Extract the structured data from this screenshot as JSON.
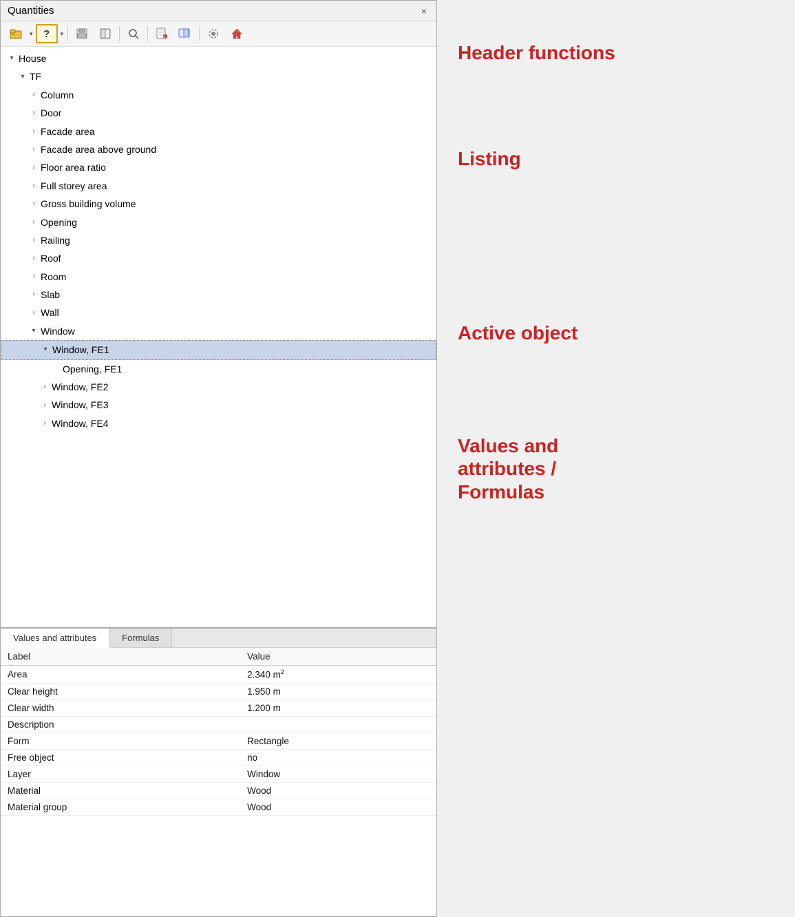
{
  "window": {
    "title": "Quantities",
    "close_label": "×"
  },
  "toolbar": {
    "buttons": [
      {
        "id": "folder-btn",
        "icon": "📁",
        "label": "Folder",
        "active": false
      },
      {
        "id": "dropdown-arrow-1",
        "icon": "▾",
        "label": "Dropdown",
        "active": false
      },
      {
        "id": "help-btn",
        "icon": "?",
        "label": "Help",
        "active": true
      },
      {
        "id": "dropdown-arrow-2",
        "icon": "▾",
        "label": "Dropdown",
        "active": false
      },
      {
        "id": "save-btn",
        "icon": "💾",
        "label": "Save",
        "active": false
      },
      {
        "id": "book-btn",
        "icon": "📓",
        "label": "Book",
        "active": false
      },
      {
        "id": "search-btn",
        "icon": "🔍",
        "label": "Search",
        "active": false
      },
      {
        "id": "report-btn",
        "icon": "📋",
        "label": "Report",
        "active": false
      },
      {
        "id": "export-btn",
        "icon": "📤",
        "label": "Export",
        "active": false
      },
      {
        "id": "settings-btn",
        "icon": "⚙",
        "label": "Settings",
        "active": false
      },
      {
        "id": "home-btn",
        "icon": "🏠",
        "label": "Home",
        "active": false
      }
    ]
  },
  "tree": {
    "items": [
      {
        "id": "house",
        "label": "House",
        "indent": 0,
        "expanded": true,
        "type": "expanded"
      },
      {
        "id": "tf",
        "label": "TF",
        "indent": 1,
        "expanded": true,
        "type": "expanded"
      },
      {
        "id": "column",
        "label": "Column",
        "indent": 2,
        "expanded": false,
        "type": "collapsed"
      },
      {
        "id": "door",
        "label": "Door",
        "indent": 2,
        "expanded": false,
        "type": "collapsed"
      },
      {
        "id": "facade-area",
        "label": "Facade area",
        "indent": 2,
        "expanded": false,
        "type": "collapsed"
      },
      {
        "id": "facade-area-above",
        "label": "Facade area above ground",
        "indent": 2,
        "expanded": false,
        "type": "collapsed"
      },
      {
        "id": "floor-area-ratio",
        "label": "Floor area ratio",
        "indent": 2,
        "expanded": false,
        "type": "collapsed"
      },
      {
        "id": "full-storey-area",
        "label": "Full storey area",
        "indent": 2,
        "expanded": false,
        "type": "collapsed"
      },
      {
        "id": "gross-building-volume",
        "label": "Gross building volume",
        "indent": 2,
        "expanded": false,
        "type": "collapsed"
      },
      {
        "id": "opening",
        "label": "Opening",
        "indent": 2,
        "expanded": false,
        "type": "collapsed"
      },
      {
        "id": "railing",
        "label": "Railing",
        "indent": 2,
        "expanded": false,
        "type": "collapsed"
      },
      {
        "id": "roof",
        "label": "Roof",
        "indent": 2,
        "expanded": false,
        "type": "collapsed"
      },
      {
        "id": "room",
        "label": "Room",
        "indent": 2,
        "expanded": false,
        "type": "collapsed"
      },
      {
        "id": "slab",
        "label": "Slab",
        "indent": 2,
        "expanded": false,
        "type": "collapsed"
      },
      {
        "id": "wall",
        "label": "Wall",
        "indent": 2,
        "expanded": false,
        "type": "collapsed"
      },
      {
        "id": "window",
        "label": "Window",
        "indent": 2,
        "expanded": true,
        "type": "expanded"
      },
      {
        "id": "window-fe1",
        "label": "Window, FE1",
        "indent": 3,
        "expanded": true,
        "type": "expanded",
        "selected": true
      },
      {
        "id": "opening-fe1",
        "label": "Opening, FE1",
        "indent": 4,
        "expanded": false,
        "type": "leaf"
      },
      {
        "id": "window-fe2",
        "label": "Window, FE2",
        "indent": 3,
        "expanded": false,
        "type": "collapsed"
      },
      {
        "id": "window-fe3",
        "label": "Window, FE3",
        "indent": 3,
        "expanded": false,
        "type": "collapsed"
      },
      {
        "id": "window-fe4",
        "label": "Window, FE4",
        "indent": 3,
        "expanded": false,
        "type": "collapsed"
      }
    ]
  },
  "tabs": [
    {
      "id": "values-tab",
      "label": "Values and attributes",
      "active": true
    },
    {
      "id": "formulas-tab",
      "label": "Formulas",
      "active": false
    }
  ],
  "values_table": {
    "headers": [
      "Label",
      "Value"
    ],
    "rows": [
      {
        "label": "Area",
        "value": "2.340 m²"
      },
      {
        "label": "Clear height",
        "value": "1.950 m"
      },
      {
        "label": "Clear width",
        "value": "1.200 m"
      },
      {
        "label": "Description",
        "value": ""
      },
      {
        "label": "Form",
        "value": "Rectangle"
      },
      {
        "label": "Free object",
        "value": "no"
      },
      {
        "label": "Layer",
        "value": "Window"
      },
      {
        "label": "Material",
        "value": "Wood"
      },
      {
        "label": "Material group",
        "value": "Wood"
      }
    ]
  },
  "annotations": {
    "header_functions": "Header functions",
    "listing": "Listing",
    "active_object": "Active object",
    "values_and_attributes": "Values and\nattributes /\nFormulas"
  }
}
